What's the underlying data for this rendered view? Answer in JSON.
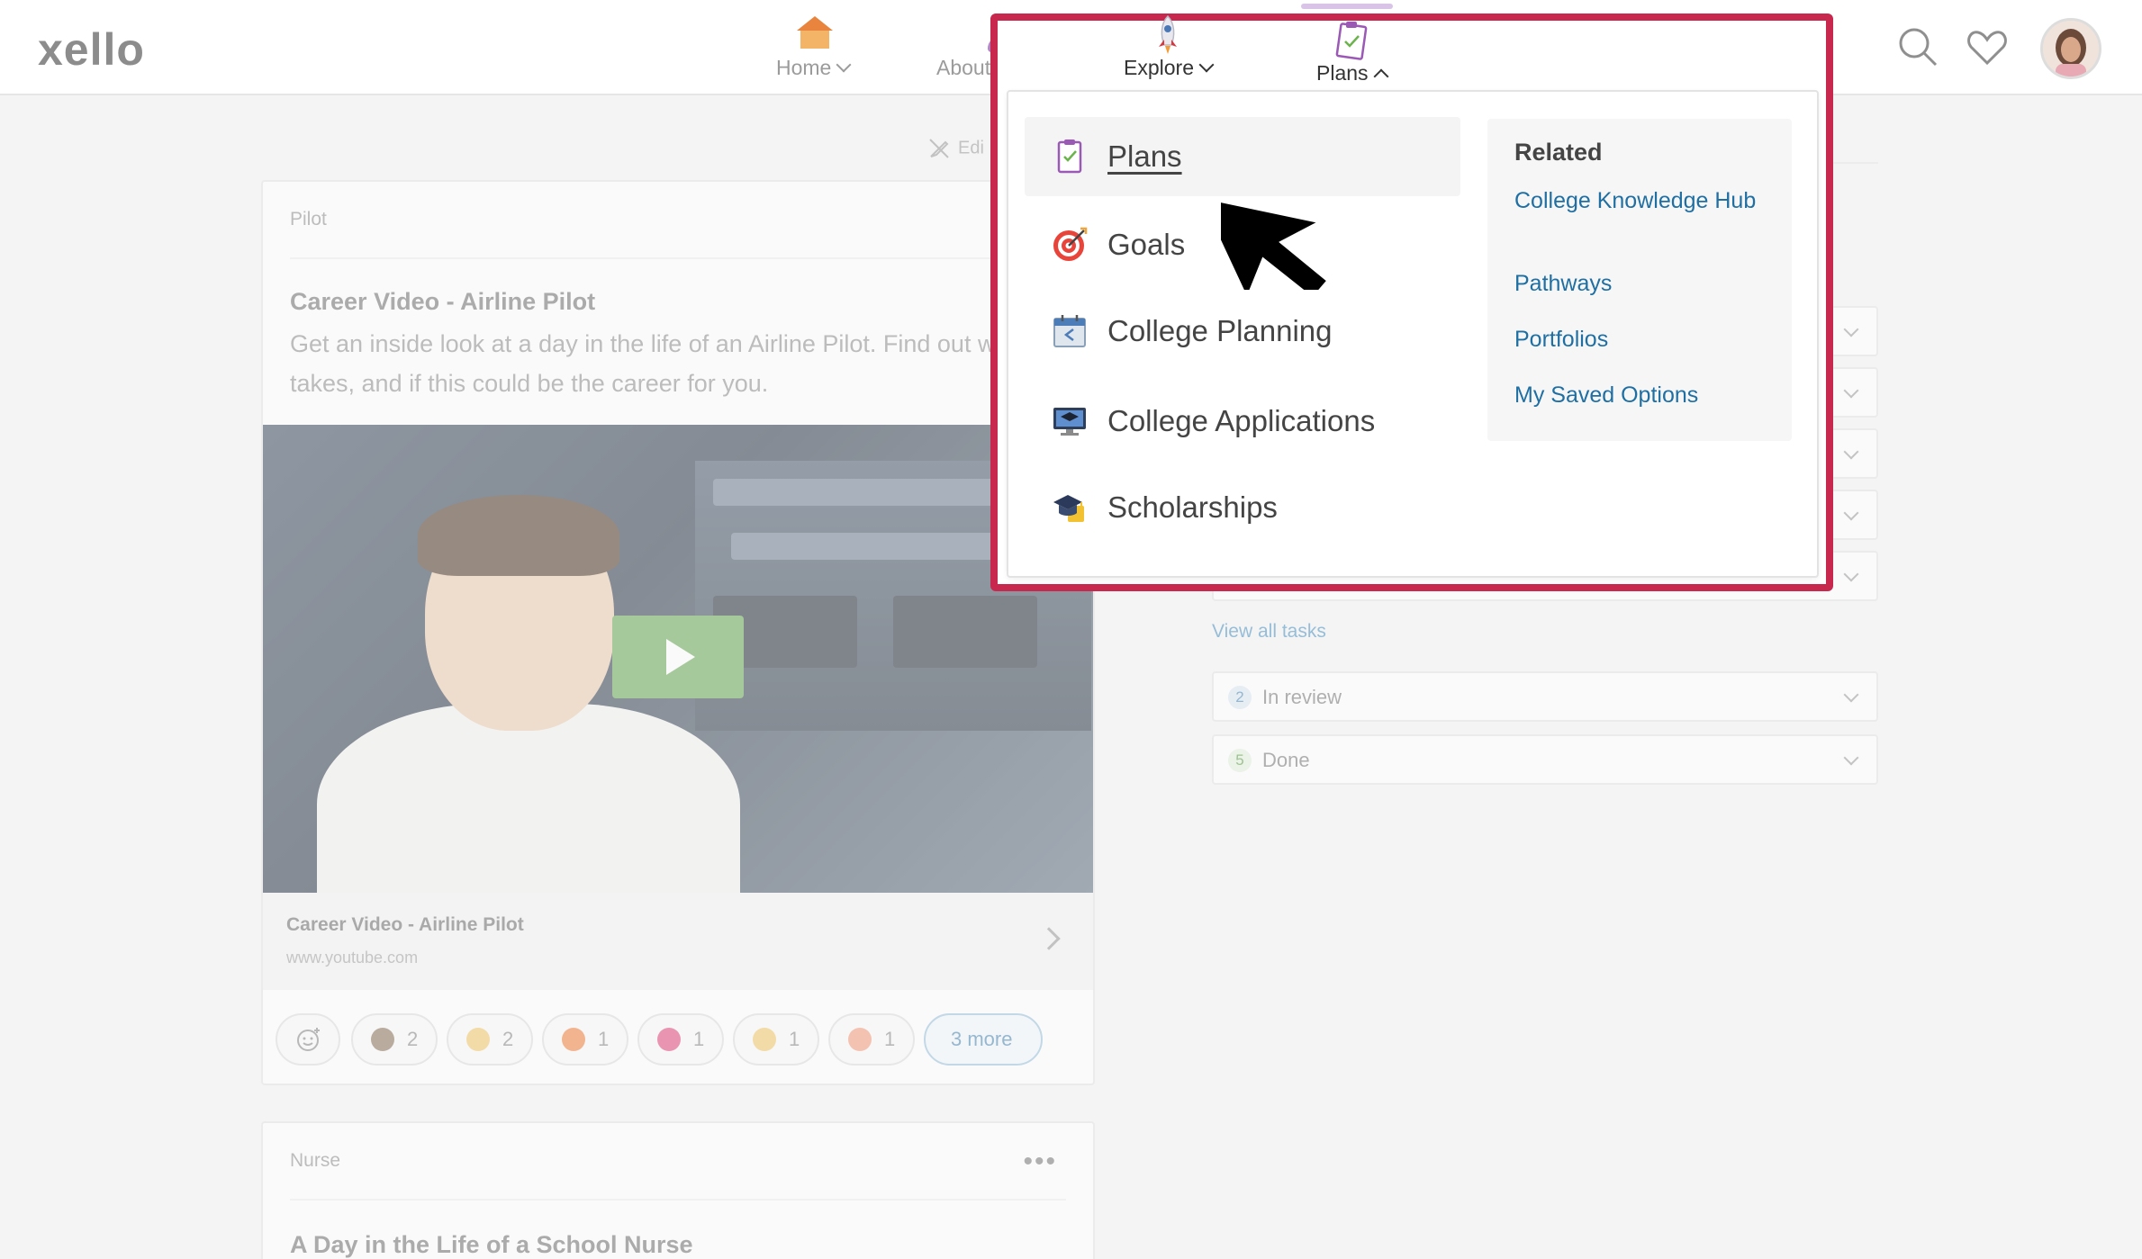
{
  "brand": {
    "logo_text": "xello"
  },
  "nav": {
    "items": [
      {
        "label": "Home",
        "icon": "house-icon"
      },
      {
        "label": "About Me",
        "icon": "person-icon"
      },
      {
        "label": "Explore",
        "icon": "rocket-icon"
      },
      {
        "label": "Plans",
        "icon": "clipboard-icon"
      }
    ],
    "right_icons": [
      "search-icon",
      "heart-icon",
      "avatar"
    ]
  },
  "background": {
    "edit_label": "Edi",
    "pilot_card": {
      "label": "Pilot",
      "title": "Career Video - Airline Pilot",
      "description": "Get an inside look at a day in the life of an Airline Pilot. Find out what it takes, and if this could be the career for you.",
      "link_title": "Career Video - Airline Pilot",
      "link_url": "www.youtube.com",
      "reactions": [
        {
          "emoji": "eyes",
          "count": "2",
          "color": "#8b6f5a"
        },
        {
          "emoji": "clap",
          "count": "2",
          "color": "#f2c76b"
        },
        {
          "emoji": "fire",
          "count": "1",
          "color": "#f0803c"
        },
        {
          "emoji": "heart-eyes",
          "count": "1",
          "color": "#e0477a"
        },
        {
          "emoji": "grimace",
          "count": "1",
          "color": "#f2c76b"
        },
        {
          "emoji": "shocked",
          "count": "1",
          "color": "#f29a7a"
        }
      ],
      "more_label": "3 more"
    },
    "nurse_card": {
      "label": "Nurse",
      "menu": "•••",
      "title": "A Day in the Life of a School Nurse"
    },
    "tasks": {
      "view_all": "View all tasks",
      "groups": [
        {
          "count": "2",
          "label": "In review",
          "color": "#dbe7f3",
          "text_color": "#4a86b2"
        },
        {
          "count": "5",
          "label": "Done",
          "color": "#e3f0dc",
          "text_color": "#5a9a44"
        }
      ]
    }
  },
  "dropdown": {
    "items": [
      {
        "label": "Plans",
        "icon": "clipboard-icon",
        "active": true
      },
      {
        "label": "Goals",
        "icon": "target-icon",
        "active": false
      },
      {
        "label": "College Planning",
        "icon": "calendar-icon",
        "active": false
      },
      {
        "label": "College Applications",
        "icon": "monitor-graduation-icon",
        "active": false
      },
      {
        "label": "Scholarships",
        "icon": "graduation-cap-icon",
        "active": false
      }
    ],
    "related": {
      "title": "Related",
      "links": [
        "College Knowledge Hub",
        "Pathways",
        "Portfolios",
        "My Saved Options"
      ]
    }
  },
  "colors": {
    "highlight_border": "#c8284d",
    "link": "#1f6fa3",
    "play_button": "#66a655"
  }
}
